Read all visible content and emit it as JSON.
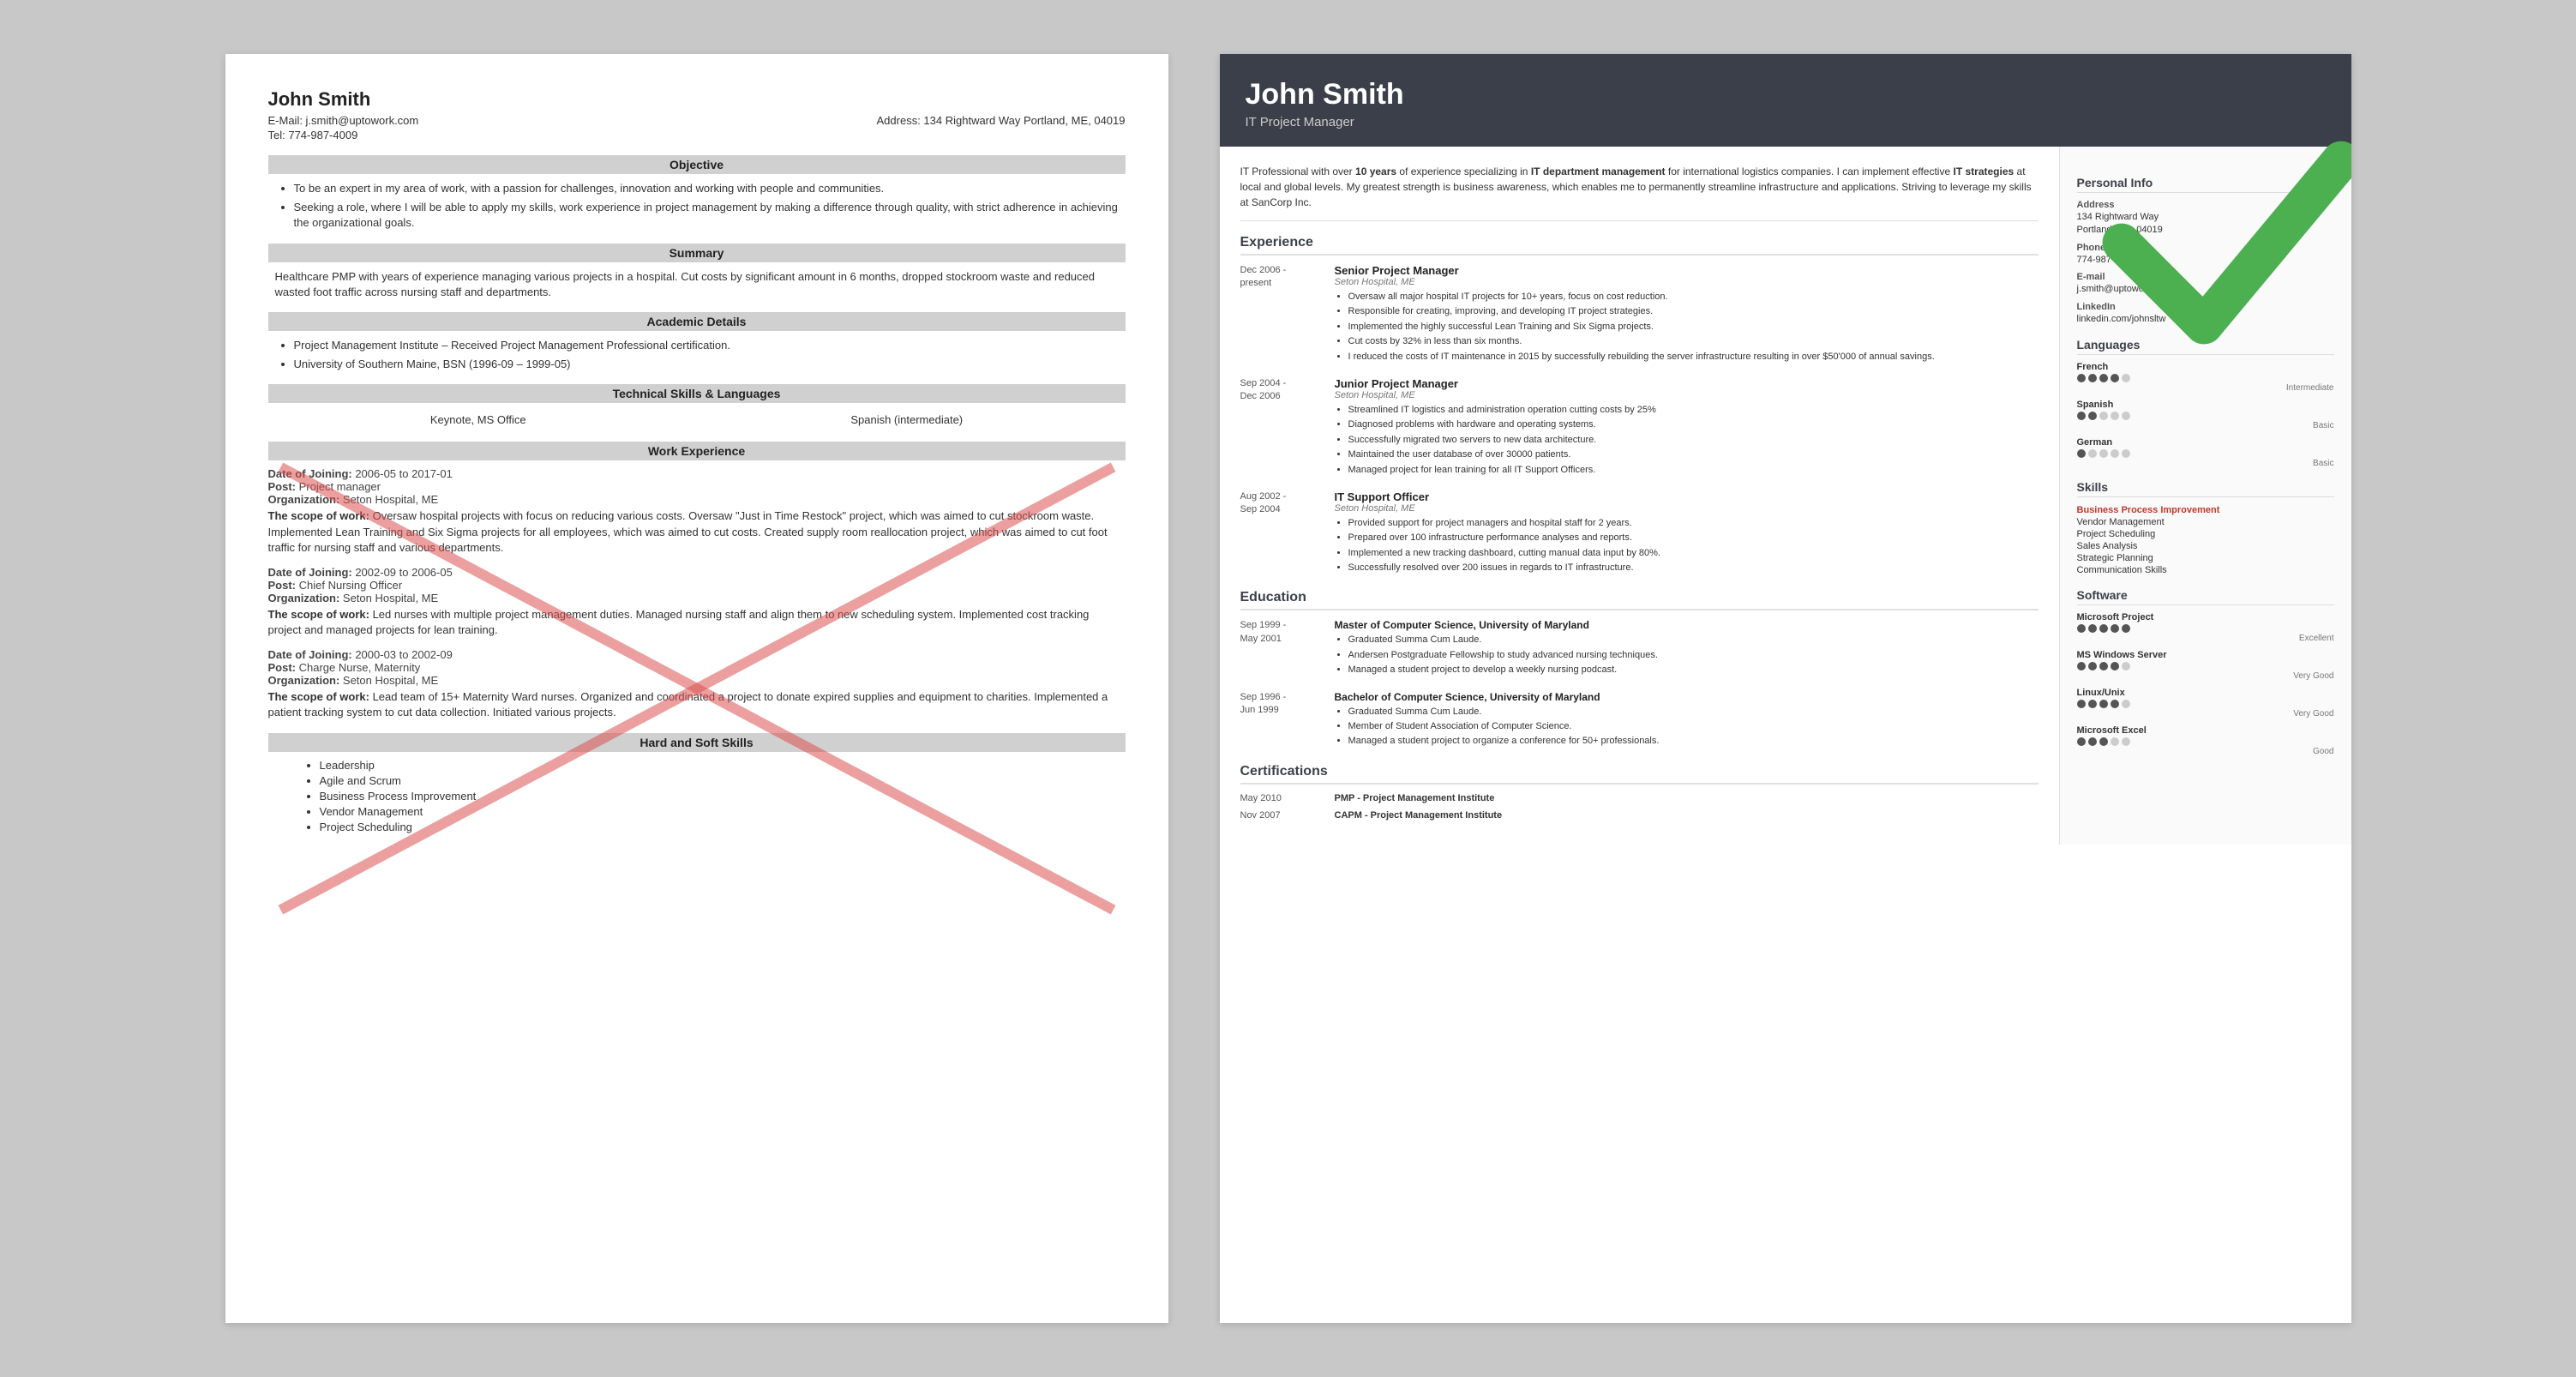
{
  "left": {
    "name": "John Smith",
    "email": "E-Mail: j.smith@uptowork.com",
    "address": "Address: 134 Rightward Way Portland, ME, 04019",
    "tel": "Tel: 774-987-4009",
    "sections": {
      "objective": {
        "title": "Objective",
        "bullets": [
          "To be an expert in my area of work, with a passion for challenges, innovation and working with people and communities.",
          "Seeking a role, where I will be able to apply my skills, work experience in project management by making a difference through quality, with strict adherence in achieving the organizational goals."
        ]
      },
      "summary": {
        "title": "Summary",
        "text": "Healthcare PMP with years of experience managing various projects in a hospital. Cut costs by significant amount in 6 months, dropped stockroom waste and reduced wasted foot traffic across nursing staff and departments."
      },
      "academic": {
        "title": "Academic Details",
        "bullets": [
          "Project Management Institute – Received Project Management Professional certification.",
          "University of Southern Maine, BSN (1996-09 – 1999-05)"
        ]
      },
      "technical": {
        "title": "Technical Skills & Languages",
        "col1": "Keynote, MS Office",
        "col2": "Spanish (intermediate)"
      },
      "work": {
        "title": "Work Experience",
        "entries": [
          {
            "date": "Date of Joining: 2006-05 to 2017-01",
            "post": "Post: Project manager",
            "org": "Organization: Seton Hospital, ME",
            "scope": "The scope of work: Oversaw hospital projects with focus on reducing various costs. Oversaw \"Just in Time Restock\" project, which was aimed to cut stockroom waste. Implemented Lean Training and Six Sigma projects for all employees, which was aimed to cut costs. Created supply room reallocation project, which was aimed to cut foot traffic for nursing staff and various departments."
          },
          {
            "date": "Date of Joining: 2002-09 to 2006-05",
            "post": "Post: Chief Nursing Officer",
            "org": "Organization: Seton Hospital, ME",
            "scope": "Led nurses with multiple project management duties. Managed nursing staff and align them to new scheduling system. Implemented cost tracking project and managed projects for lean training."
          },
          {
            "date": "Date of Joining: 2000-03 to 2002-09",
            "post": "Post: Charge Nurse, Maternity",
            "org": "Organization: Seton Hospital, ME",
            "scope": "Lead team of 15+ Maternity Ward nurses. Organized and coordinated a project to donate expired supplies and equipment to charities. Implemented a patient tracking system to cut data collection. Initiated various projects."
          }
        ]
      },
      "hardsoft": {
        "title": "Hard and Soft Skills",
        "items": [
          "Leadership",
          "Agile and Scrum",
          "Business Process Improvement",
          "Vendor Management",
          "Project Scheduling"
        ]
      }
    }
  },
  "right": {
    "name": "John Smith",
    "title": "IT Project Manager",
    "summary": "IT Professional with over 10 years of experience specializing in IT department management for international logistics companies. I can implement effective IT strategies at local and global levels. My greatest strength is business awareness, which enables me to permanently streamline infrastructure and applications. Striving to leverage my skills at SanCorp Inc.",
    "personal": {
      "title": "Personal Info",
      "address_label": "Address",
      "address": "134 Rightward Way\nPortland, ME, 04019",
      "phone_label": "Phone",
      "phone": "774-987-4009",
      "email_label": "E-mail",
      "email": "j.smith@uptowork.com",
      "linkedin_label": "LinkedIn",
      "linkedin": "linkedin.com/johnsltw"
    },
    "languages": {
      "title": "Languages",
      "items": [
        {
          "name": "French",
          "dots": 4,
          "level": "Intermediate"
        },
        {
          "name": "Spanish",
          "dots": 2,
          "level": "Basic"
        },
        {
          "name": "German",
          "dots": 1,
          "level": "Basic"
        }
      ]
    },
    "skills": {
      "title": "Skills",
      "items": [
        {
          "label": "Business Process Improvement",
          "highlight": true
        },
        {
          "label": "Vendor Management",
          "highlight": false
        },
        {
          "label": "Project Scheduling",
          "highlight": false
        },
        {
          "label": "Sales Analysis",
          "highlight": false
        },
        {
          "label": "Strategic Planning",
          "highlight": false
        },
        {
          "label": "Communication Skills",
          "highlight": false
        }
      ]
    },
    "software": {
      "title": "Software",
      "items": [
        {
          "name": "Microsoft Project",
          "dots": 5,
          "level": "Excellent"
        },
        {
          "name": "MS Windows Server",
          "dots": 4,
          "level": "Very Good"
        },
        {
          "name": "Linux/Unix",
          "dots": 4,
          "level": "Very Good"
        },
        {
          "name": "Microsoft Excel",
          "dots": 3,
          "level": "Good"
        }
      ]
    },
    "experience": {
      "title": "Experience",
      "entries": [
        {
          "date_start": "Dec 2006 -",
          "date_end": "present",
          "role": "Senior Project Manager",
          "org": "Seton Hospital, ME",
          "bullets": [
            "Oversaw all major hospital IT projects for 10+ years, focus on cost reduction.",
            "Responsible for creating, improving, and developing IT project strategies.",
            "Implemented the highly successful Lean Training and Six Sigma projects.",
            "Cut costs by 32% in less than six months.",
            "I reduced the costs of IT maintenance in 2015 by successfully rebuilding the server infrastructure resulting in over $50'000 of annual savings."
          ]
        },
        {
          "date_start": "Sep 2004 -",
          "date_end": "Dec 2006",
          "role": "Junior Project Manager",
          "org": "Seton Hospital, ME",
          "bullets": [
            "Streamlined IT logistics and administration operation cutting costs by 25%",
            "Diagnosed problems with hardware and operating systems.",
            "Successfully migrated two servers to new data architecture.",
            "Maintained the user database of over 30000 patients.",
            "Managed project for lean training for all IT Support Officers."
          ]
        },
        {
          "date_start": "Aug 2002 -",
          "date_end": "Sep 2004",
          "role": "IT Support Officer",
          "org": "Seton Hospital, ME",
          "bullets": [
            "Provided support for project managers and hospital staff for 2 years.",
            "Prepared over 100 infrastructure performance analyses and reports.",
            "Implemented a new tracking dashboard, cutting manual data input by 80%.",
            "Successfully resolved over 200 issues in regards to IT infrastructure."
          ]
        }
      ]
    },
    "education": {
      "title": "Education",
      "entries": [
        {
          "date_start": "Sep 1999 -",
          "date_end": "May 2001",
          "degree": "Master of Computer Science, University of Maryland",
          "bullets": [
            "Graduated Summa Cum Laude.",
            "Andersen Postgraduate Fellowship to study advanced nursing techniques.",
            "Managed a student project to develop a weekly nursing podcast."
          ]
        },
        {
          "date_start": "Sep 1996 -",
          "date_end": "Jun 1999",
          "degree": "Bachelor of Computer Science, University of Maryland",
          "bullets": [
            "Graduated Summa Cum Laude.",
            "Member of Student Association of Computer Science.",
            "Managed a student project to organize a conference for 50+ professionals."
          ]
        }
      ]
    },
    "certifications": {
      "title": "Certifications",
      "entries": [
        {
          "date": "May 2010",
          "name": "PMP - Project Management Institute"
        },
        {
          "date": "Nov 2007",
          "name": "CAPM - Project Management Institute"
        }
      ]
    }
  }
}
